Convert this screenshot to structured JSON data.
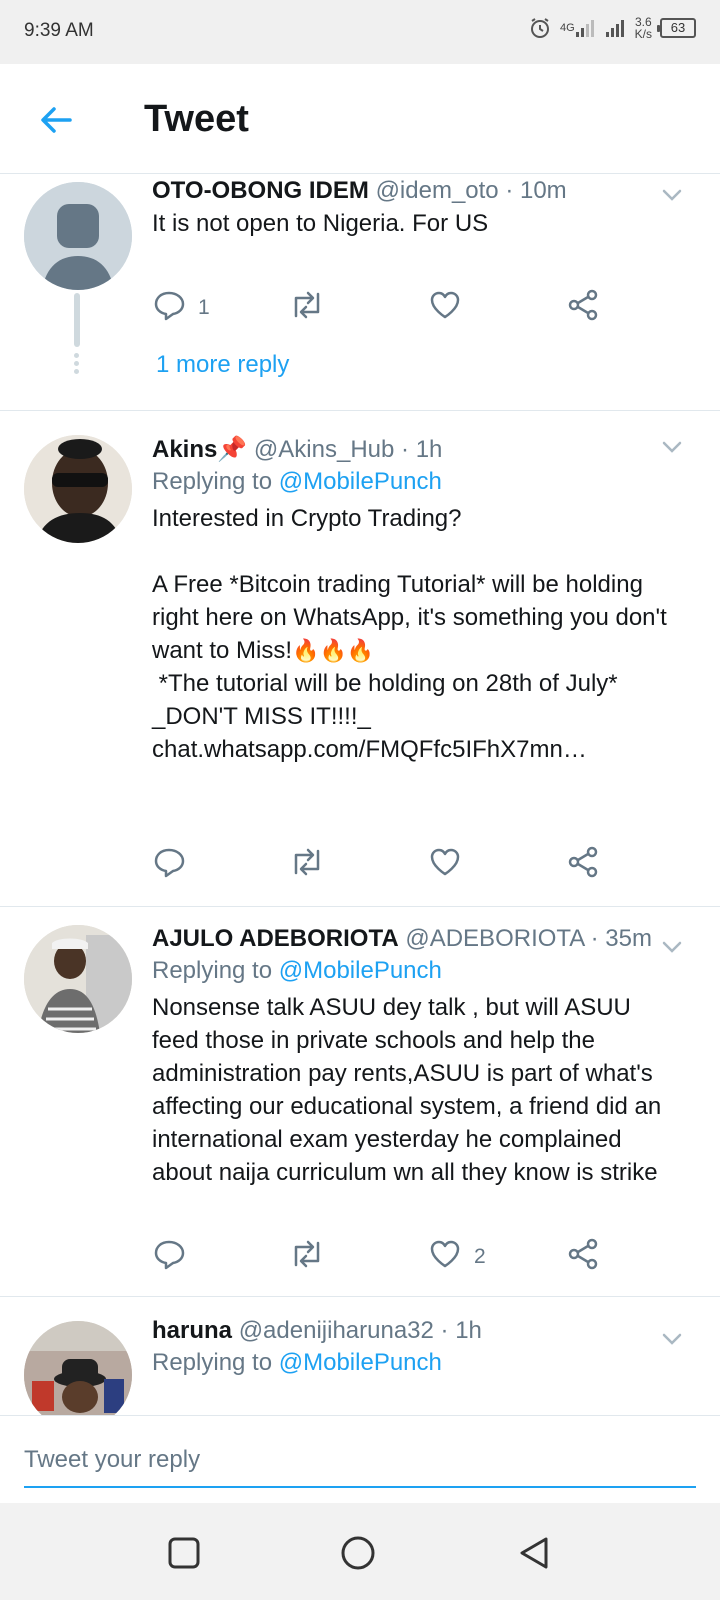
{
  "status_bar": {
    "time": "9:39 AM",
    "network": "4G",
    "speed_value": "3.6",
    "speed_unit": "K/s",
    "battery": "63"
  },
  "header": {
    "title": "Tweet"
  },
  "tweets": [
    {
      "name": "OTO-OBONG IDEM",
      "handle": "@idem_oto",
      "time": "· 10m",
      "body": "It is not open to Nigeria. For US",
      "reply_count": "1",
      "more_replies": "1 more reply"
    },
    {
      "name": "Akins📌",
      "handle": "@Akins_Hub",
      "time": "· 1h",
      "replying_prefix": "Replying to",
      "replying_to": "@MobilePunch",
      "body": "Interested in Crypto Trading?\n\nA Free *Bitcoin trading Tutorial* will be holding right here on WhatsApp, it's something you don't want to Miss!",
      "body_emoji": "🔥🔥🔥",
      "body_2": "\n *The tutorial will be holding on 28th of July*\n_DON'T MISS IT!!!!_",
      "link": "chat.whatsapp.com/FMQFfc5IFhX7mn…"
    },
    {
      "name": "AJULO ADEBORIOTA",
      "handle": "@ADEBORIOTA",
      "time": "· 35m",
      "replying_prefix": "Replying to",
      "replying_to": "@MobilePunch",
      "body": "Nonsense talk ASUU dey talk , but will ASUU feed those in private schools and help the administration pay rents,ASUU is part of what's affecting our educational system, a friend did an international exam yesterday he complained about naija curriculum wn all they know is strike",
      "like_count": "2"
    },
    {
      "name": "haruna",
      "handle": "@adenijiharuna32",
      "time": "· 1h",
      "replying_prefix": "Replying to",
      "replying_to": "@MobilePunch"
    }
  ],
  "reply_bar": {
    "placeholder": "Tweet your reply"
  },
  "colors": {
    "accent": "#1da1f2",
    "secondary_text": "#657786",
    "divider": "#e1e8ed"
  }
}
